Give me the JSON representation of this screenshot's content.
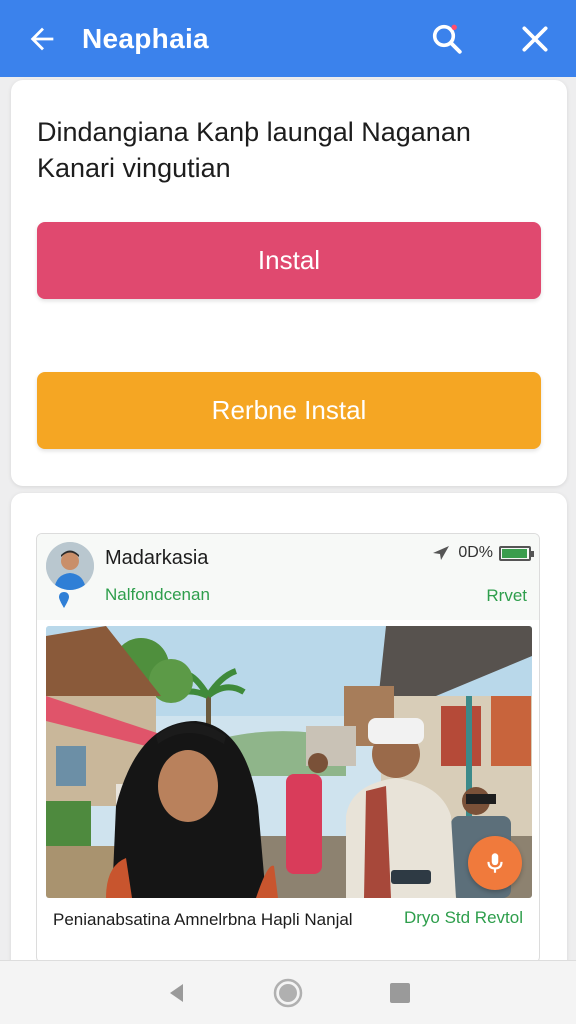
{
  "appbar": {
    "title": "Neaphaia",
    "color": "#3b82ec",
    "icons": [
      "arrow-back-icon",
      "search-icon",
      "close-icon"
    ]
  },
  "promo": {
    "headline": "Dindangiana Kanþ laungal Naganan Kanari vingutian",
    "install_label": "Instal",
    "install_color": "#e0496f",
    "secondary_label": "Rerbne Instal",
    "secondary_color": "#f5a623"
  },
  "post": {
    "author": "Madarkasia",
    "subtitle": "Nalfondcenan",
    "status_text": "0D%",
    "reply_label": "Rrvet",
    "caption": "Penianabsatina Amnelrbna Hapli Nanjal",
    "location": "Dryo Std Revtol",
    "accent": "#2e9e4c"
  },
  "navbar": {
    "icons": [
      "nav-back-icon",
      "nav-home-icon",
      "nav-recents-icon"
    ]
  }
}
